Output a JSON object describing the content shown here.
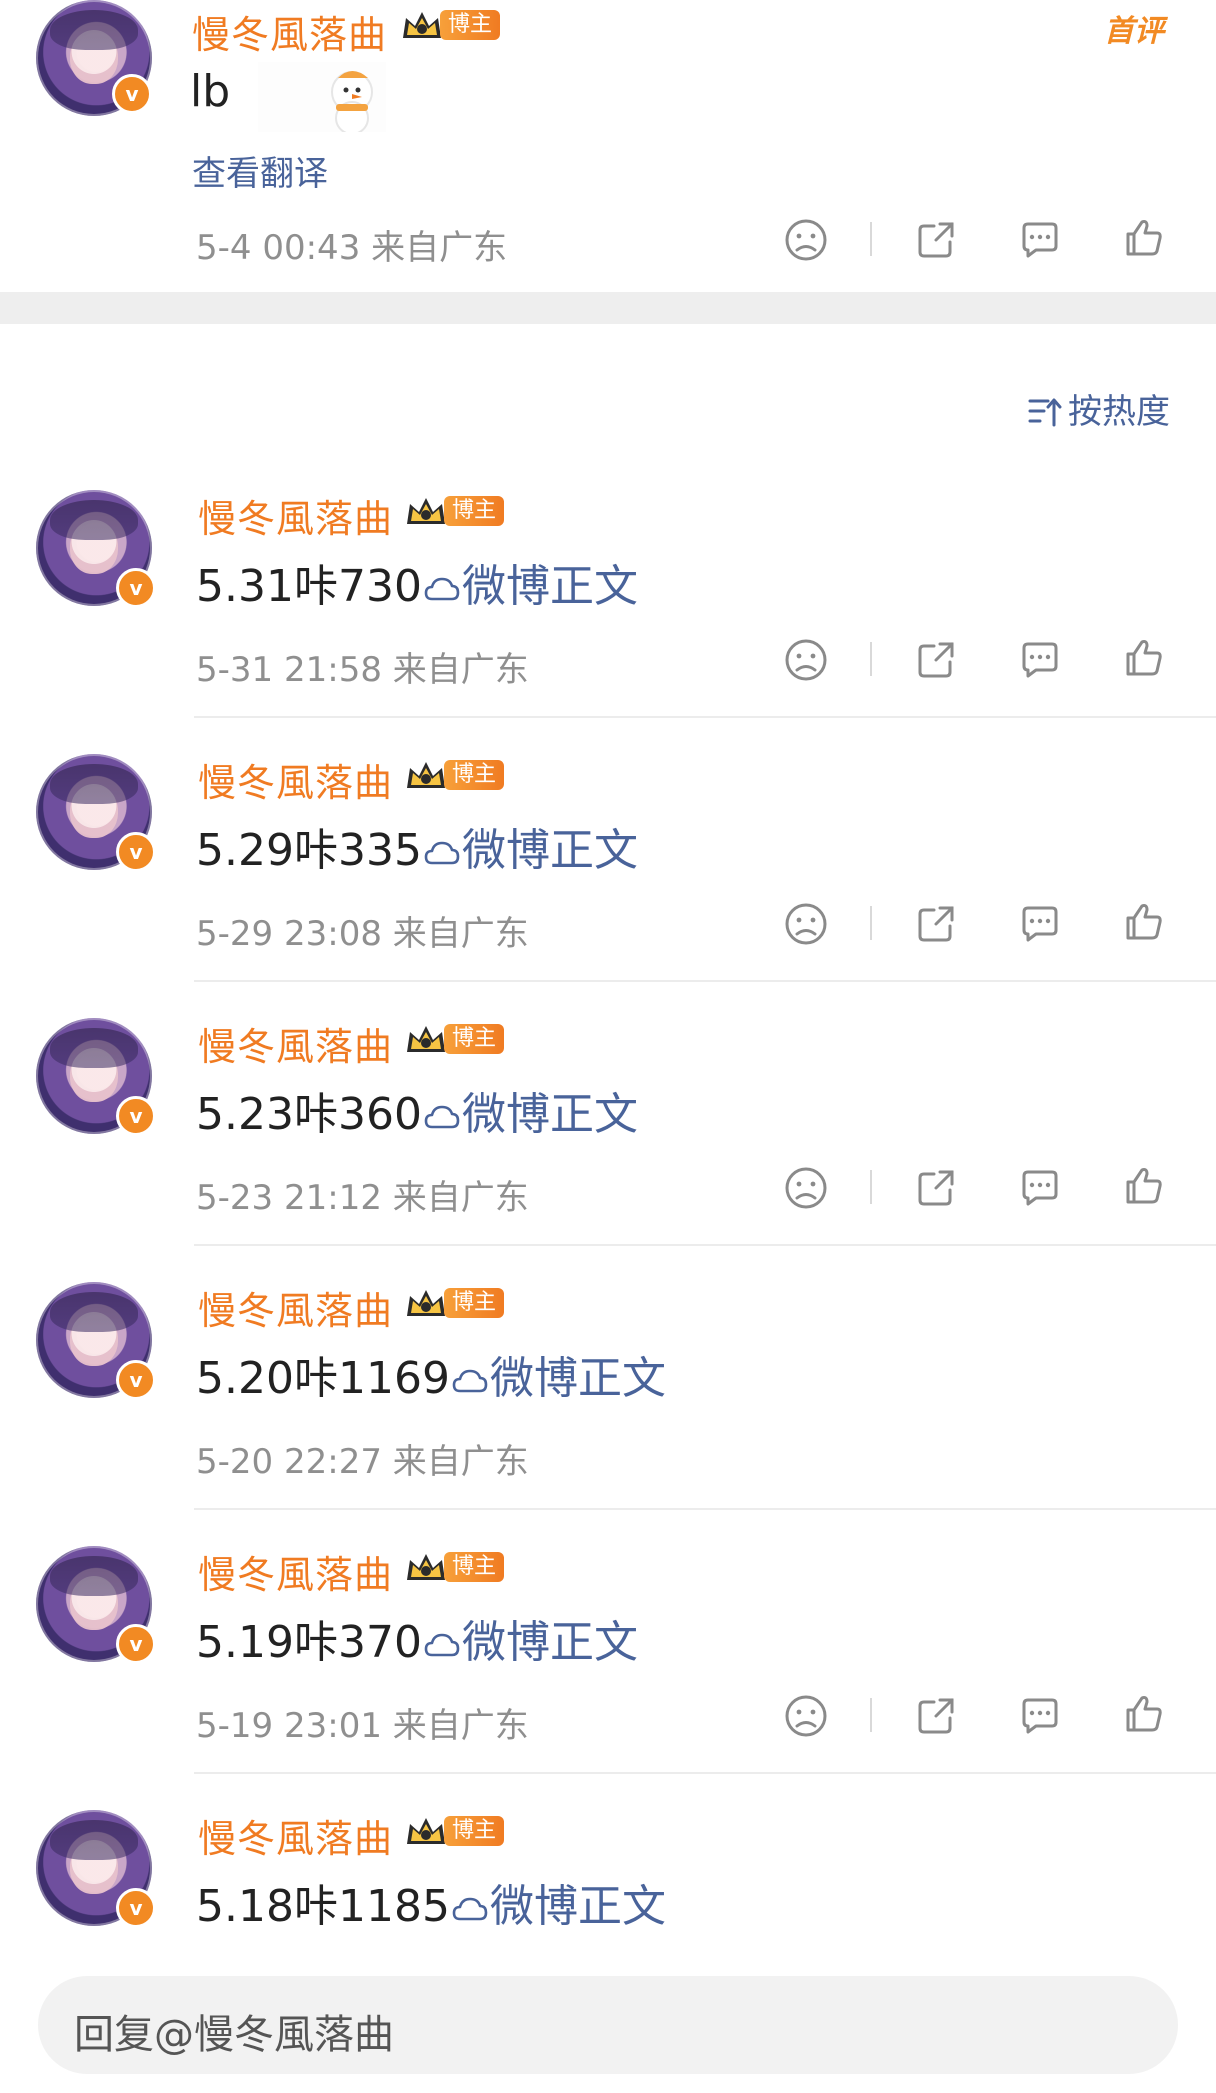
{
  "colors": {
    "username": "#f07b22",
    "link": "#49639a",
    "meta": "#8f8f8f",
    "tag_bg": "#f07b22"
  },
  "top_comment": {
    "username": "慢冬風落曲",
    "tag": "博主",
    "text": "lb",
    "translate_label": "查看翻译",
    "first_badge": "首评",
    "meta": "5-4 00:43  来自广东",
    "actions": [
      "dislike-icon",
      "share-icon",
      "comment-icon",
      "like-icon"
    ]
  },
  "sort": {
    "label": "按热度",
    "icon": "sort-icon"
  },
  "replies": [
    {
      "username": "慢冬風落曲",
      "tag": "博主",
      "text": "5.31咔730",
      "link_label": "微博正文",
      "meta": "5-31 21:58  来自广东",
      "show_actions": true
    },
    {
      "username": "慢冬風落曲",
      "tag": "博主",
      "text": "5.29咔335",
      "link_label": "微博正文",
      "meta": "5-29 23:08  来自广东",
      "show_actions": true
    },
    {
      "username": "慢冬風落曲",
      "tag": "博主",
      "text": "5.23咔360",
      "link_label": "微博正文",
      "meta": "5-23 21:12  来自广东",
      "show_actions": true
    },
    {
      "username": "慢冬風落曲",
      "tag": "博主",
      "text": "5.20咔1169",
      "link_label": "微博正文",
      "meta": "5-20 22:27  来自广东",
      "show_actions": false
    },
    {
      "username": "慢冬風落曲",
      "tag": "博主",
      "text": "5.19咔370",
      "link_label": "微博正文",
      "meta": "5-19 23:01  来自广东",
      "show_actions": true
    },
    {
      "username": "慢冬風落曲",
      "tag": "博主",
      "text": "5.18咔1185",
      "link_label": "微博正文",
      "meta": "",
      "show_actions": false
    }
  ],
  "reply_bar": {
    "placeholder": "回复@慢冬風落曲"
  }
}
